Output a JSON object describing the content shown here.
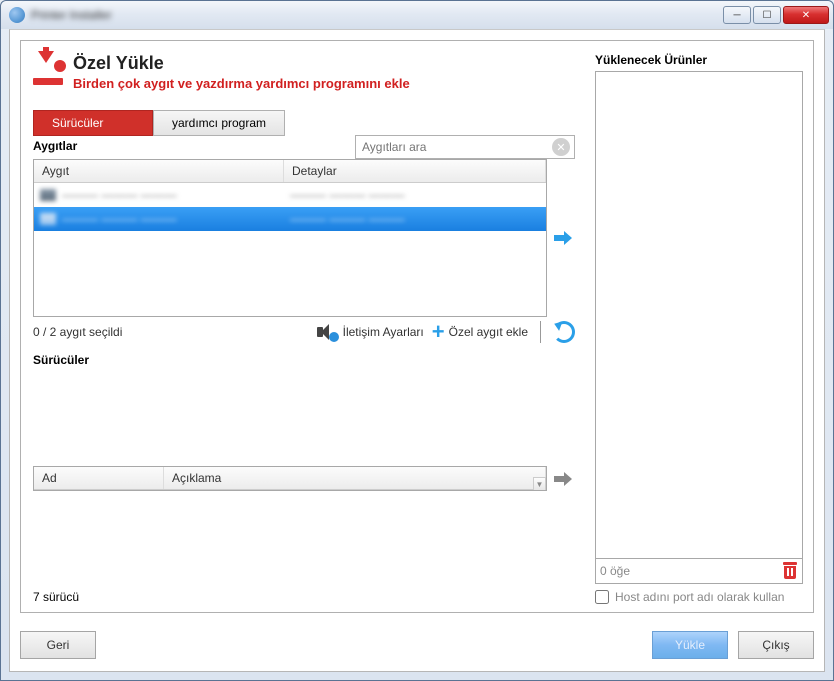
{
  "titlebar": {
    "title": "Printer Installer"
  },
  "header": {
    "title": "Özel Yükle",
    "subtitle": "Birden çok aygıt ve yazdırma yardımcı programını ekle"
  },
  "tabs": {
    "drivers": "Sürücüler",
    "utility": "yardımcı program"
  },
  "devices": {
    "label": "Aygıtlar",
    "search_placeholder": "Aygıtları ara",
    "col_device": "Aygıt",
    "col_details": "Detaylar",
    "rows": [
      {
        "name": "——— ——— ———",
        "details": "——— ——— ———"
      },
      {
        "name": "——— ——— ———",
        "details": "——— ——— ———"
      }
    ],
    "selection_text": "0 / 2 aygıt seçildi",
    "comm_settings": "İletişim Ayarları",
    "add_custom": "Özel aygıt ekle"
  },
  "drivers": {
    "label": "Sürücüler",
    "col_name": "Ad",
    "col_desc": "Açıklama",
    "rows": [
      {
        "name": "———",
        "desc": "——————————————"
      },
      {
        "name": "———",
        "desc": "——————————————"
      },
      {
        "name": "———",
        "desc": "——————————————"
      },
      {
        "name": "———",
        "desc": "——————————————"
      },
      {
        "name": "———",
        "desc": "——————————————"
      },
      {
        "name": "———",
        "desc": "——————————————"
      }
    ],
    "count_text": "7 sürücü"
  },
  "right": {
    "title": "Yüklenecek Ürünler",
    "count": "0 öğe",
    "host_checkbox": "Host adını port adı olarak kullan"
  },
  "buttons": {
    "back": "Geri",
    "install": "Yükle",
    "exit": "Çıkış"
  }
}
